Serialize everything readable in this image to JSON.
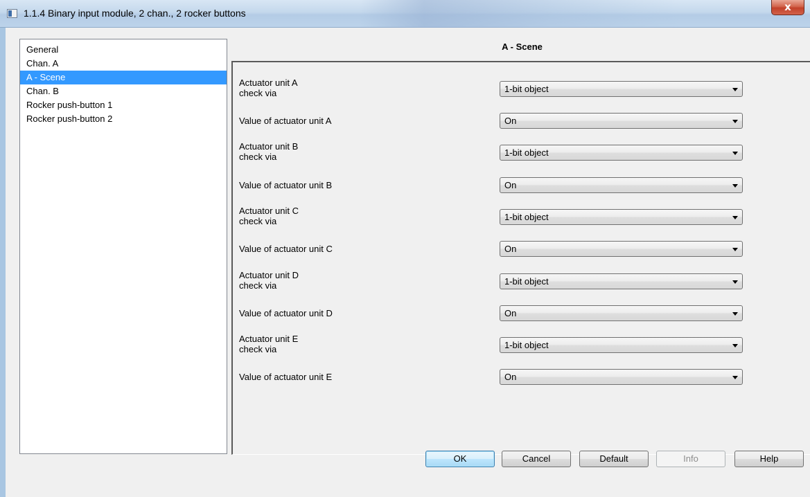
{
  "window": {
    "title": "1.1.4 Binary input module, 2 chan., 2 rocker buttons",
    "close_label": "x"
  },
  "tree": {
    "items": [
      {
        "label": "General",
        "selected": false
      },
      {
        "label": "Chan. A",
        "selected": false
      },
      {
        "label": "A - Scene",
        "selected": true
      },
      {
        "label": "Chan. B",
        "selected": false
      },
      {
        "label": "Rocker push-button 1",
        "selected": false
      },
      {
        "label": "Rocker push-button 2",
        "selected": false
      }
    ]
  },
  "panel": {
    "title": "A - Scene",
    "params": [
      {
        "label_line1": "Actuator unit A",
        "label_line2": "check via",
        "value": "1-bit object"
      },
      {
        "label_line1": "Value of actuator unit A",
        "label_line2": "",
        "value": "On"
      },
      {
        "label_line1": "Actuator unit B",
        "label_line2": "check via",
        "value": "1-bit object"
      },
      {
        "label_line1": "Value of actuator unit B",
        "label_line2": "",
        "value": "On"
      },
      {
        "label_line1": "Actuator unit C",
        "label_line2": "check via",
        "value": "1-bit object"
      },
      {
        "label_line1": "Value of actuator unit C",
        "label_line2": "",
        "value": "On"
      },
      {
        "label_line1": "Actuator unit D",
        "label_line2": "check via",
        "value": "1-bit object"
      },
      {
        "label_line1": "Value of actuator unit D",
        "label_line2": "",
        "value": "On"
      },
      {
        "label_line1": "Actuator unit E",
        "label_line2": "check via",
        "value": "1-bit object"
      },
      {
        "label_line1": "Value of actuator unit E",
        "label_line2": "",
        "value": "On"
      }
    ]
  },
  "buttons": {
    "ok": "OK",
    "cancel": "Cancel",
    "default": "Default",
    "info": "Info",
    "help": "Help"
  },
  "colors": {
    "selection": "#3399ff",
    "dialog_bg": "#f0f0f0",
    "close_button": "#c94a33"
  }
}
